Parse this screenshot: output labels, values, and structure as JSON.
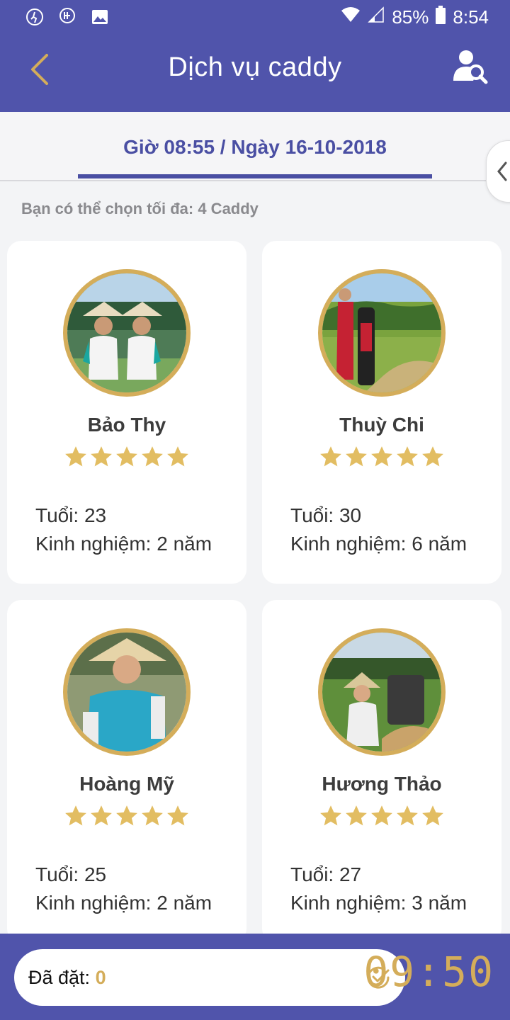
{
  "status_bar": {
    "battery": "85%",
    "time": "8:54"
  },
  "app_bar": {
    "title": "Dịch vụ caddy"
  },
  "date_tab": {
    "label": "Giờ 08:55 / Ngày 16-10-2018"
  },
  "hint": "Bạn có thể chọn tối đa: 4 Caddy",
  "caddies": [
    {
      "name": "Bảo Thy",
      "rating": 5,
      "age": "Tuổi: 23",
      "experience": "Kinh nghiệm: 2 năm"
    },
    {
      "name": "Thuỳ Chi",
      "rating": 5,
      "age": "Tuổi: 30",
      "experience": "Kinh nghiệm: 6 năm"
    },
    {
      "name": "Hoàng Mỹ",
      "rating": 5,
      "age": "Tuổi: 25",
      "experience": "Kinh nghiệm: 2 năm"
    },
    {
      "name": "Hương Thảo",
      "rating": 5,
      "age": "Tuổi: 27",
      "experience": "Kinh nghiệm: 3 năm"
    }
  ],
  "booking": {
    "label": "Đã đặt: ",
    "count": "0"
  },
  "timer": "09:50",
  "colors": {
    "primary": "#5054ab",
    "accent": "#d4ad5a"
  }
}
